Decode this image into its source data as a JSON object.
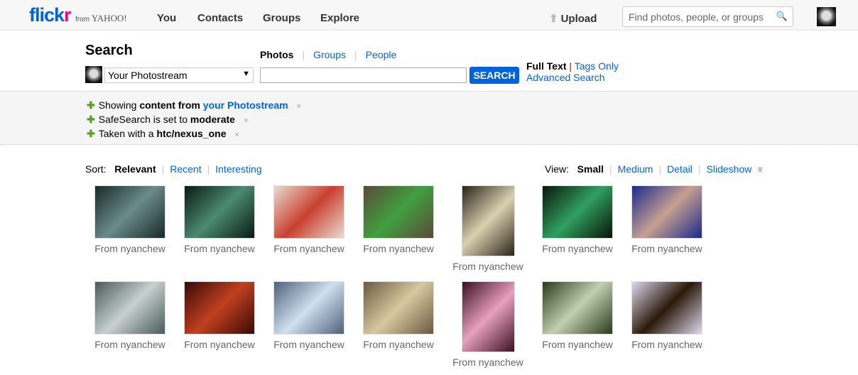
{
  "header": {
    "logo": {
      "flick": "flick",
      "r": "r",
      "from": "from",
      "yahoo": "YAHOO!"
    },
    "nav": [
      "You",
      "Contacts",
      "Groups",
      "Explore"
    ],
    "upload": "Upload",
    "search_placeholder": "Find photos, people, or groups"
  },
  "search": {
    "title": "Search",
    "tabs": [
      "Photos",
      "Groups",
      "People"
    ],
    "active_tab": "Photos",
    "scope": "Your Photostream",
    "query": "",
    "button": "SEARCH",
    "full_text": "Full Text",
    "tags_only": "Tags Only",
    "advanced": "Advanced Search"
  },
  "filters": [
    {
      "pre": "Showing ",
      "bold": "content from ",
      "link": "your Photostream"
    },
    {
      "pre": "SafeSearch is set to ",
      "bold": "moderate",
      "link": ""
    },
    {
      "pre": "Taken with a ",
      "bold": "htc/nexus_one",
      "link": ""
    }
  ],
  "sort": {
    "label": "Sort:",
    "options": [
      "Relevant",
      "Recent",
      "Interesting"
    ],
    "active": "Relevant"
  },
  "view": {
    "label": "View:",
    "options": [
      "Small",
      "Medium",
      "Detail",
      "Slideshow"
    ],
    "active": "Small"
  },
  "photos": [
    {
      "caption": "From nyanchew",
      "orientation": "landscape",
      "colors": [
        "#1a2a2a",
        "#6a8a8a"
      ]
    },
    {
      "caption": "From nyanchew",
      "orientation": "landscape",
      "colors": [
        "#0a1a14",
        "#4a8a70"
      ]
    },
    {
      "caption": "From nyanchew",
      "orientation": "landscape",
      "colors": [
        "#e8dcd0",
        "#c84030"
      ]
    },
    {
      "caption": "From nyanchew",
      "orientation": "landscape",
      "colors": [
        "#5a4a3a",
        "#40a040"
      ]
    },
    {
      "caption": "From nyanchew",
      "orientation": "portrait",
      "colors": [
        "#2a2418",
        "#d8d0b0"
      ]
    },
    {
      "caption": "From nyanchew",
      "orientation": "landscape",
      "colors": [
        "#0a140a",
        "#30a060"
      ]
    },
    {
      "caption": "From nyanchew",
      "orientation": "landscape",
      "colors": [
        "#1a2a8a",
        "#c8a090"
      ]
    },
    {
      "caption": "From nyanchew",
      "orientation": "landscape",
      "colors": [
        "#4a5a5a",
        "#c8d0d0"
      ]
    },
    {
      "caption": "From nyanchew",
      "orientation": "landscape",
      "colors": [
        "#3a0a08",
        "#c04020"
      ]
    },
    {
      "caption": "From nyanchew",
      "orientation": "landscape",
      "colors": [
        "#50607a",
        "#d0e0f0"
      ]
    },
    {
      "caption": "From nyanchew",
      "orientation": "landscape",
      "colors": [
        "#6a5a40",
        "#d8c8a0"
      ]
    },
    {
      "caption": "From nyanchew",
      "orientation": "portrait",
      "colors": [
        "#3a1020",
        "#e8a0c0"
      ]
    },
    {
      "caption": "From nyanchew",
      "orientation": "landscape",
      "colors": [
        "#2a3a1a",
        "#c0d0b0"
      ]
    },
    {
      "caption": "From nyanchew",
      "orientation": "landscape",
      "colors": [
        "#e0d8f0",
        "#2a1a08"
      ]
    }
  ]
}
